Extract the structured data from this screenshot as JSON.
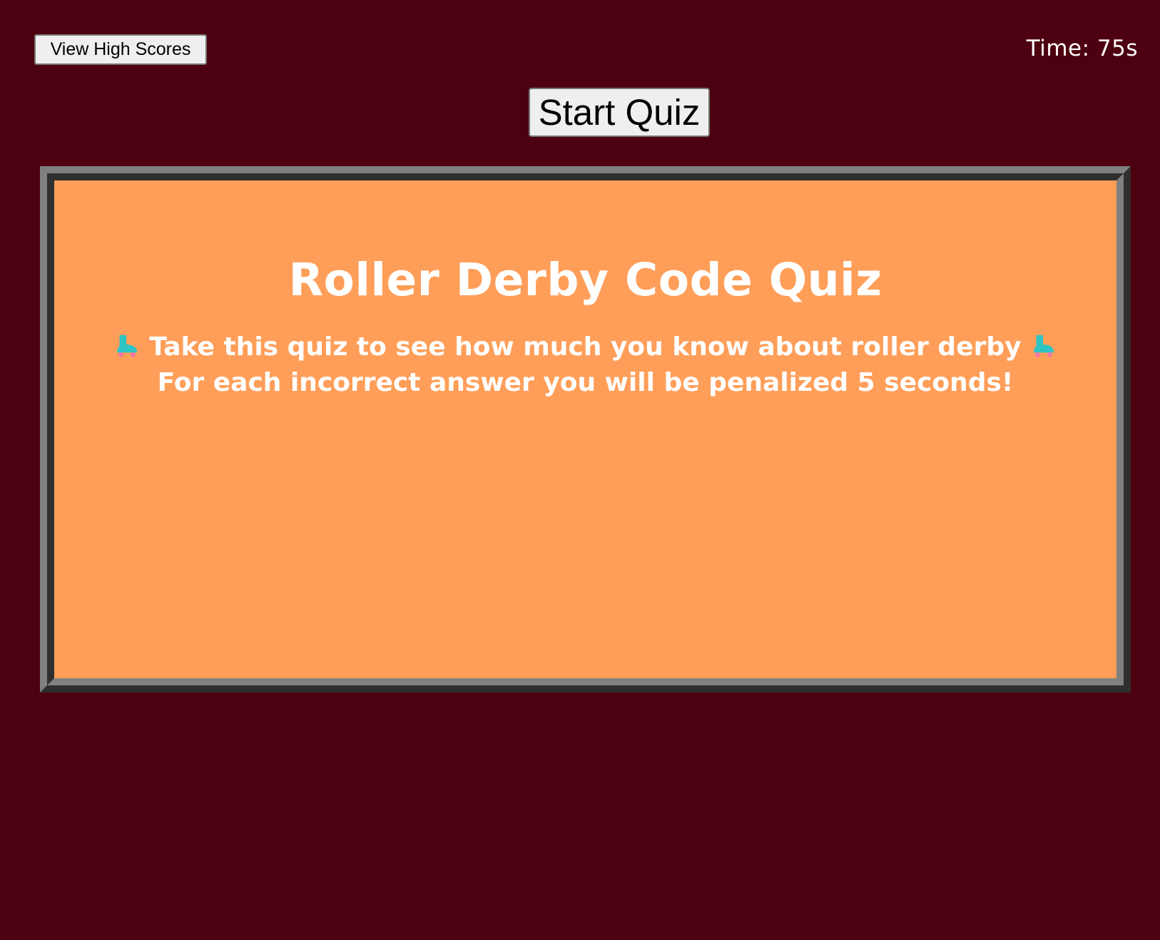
{
  "header": {
    "high_scores_label": "View High Scores",
    "timer_text": "Time: 75s"
  },
  "controls": {
    "start_label": "Start Quiz"
  },
  "quiz": {
    "title": "Roller Derby Code Quiz",
    "intro_line": "Take this quiz to see how much you know about roller derby",
    "penalty_line": "For each incorrect answer you will be penalized 5 seconds!",
    "intro_icon": "roller-skate-icon"
  },
  "colors": {
    "page_background": "#4d000f",
    "panel_background": "#ff9e59",
    "text_light": "#ffffff",
    "frame_light": "#808080",
    "frame_dark": "#2f2f2f",
    "skate_boot": "#2ec4c4",
    "skate_wheels": "#f277a8"
  }
}
